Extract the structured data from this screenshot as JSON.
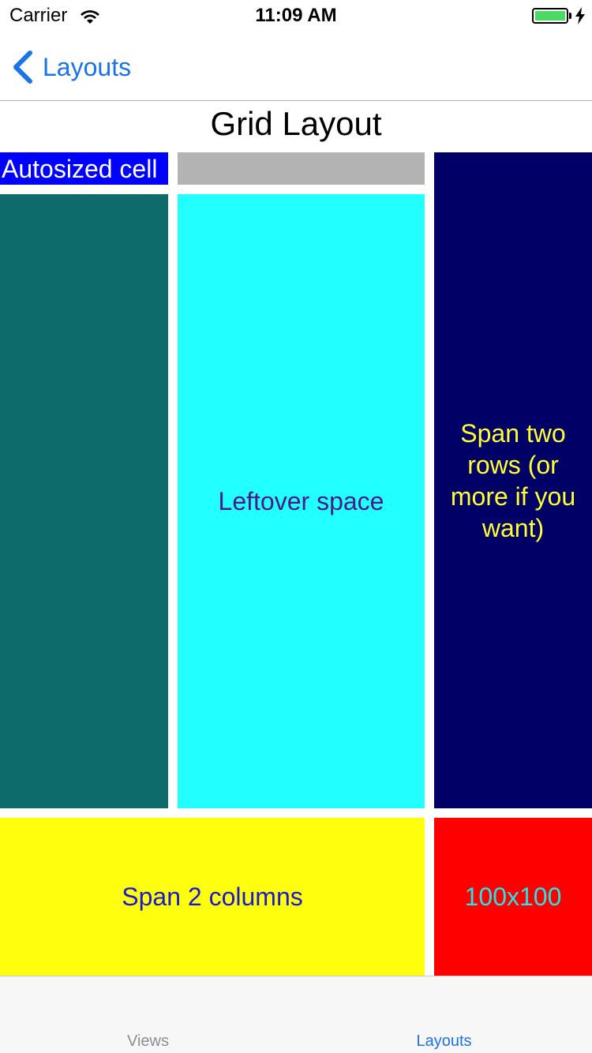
{
  "status_bar": {
    "carrier": "Carrier",
    "time": "11:09 AM",
    "icons": [
      "wifi-icon",
      "battery-icon",
      "charging-bolt-icon"
    ],
    "battery_level": 1.0
  },
  "nav_bar": {
    "back_label": "Layouts",
    "back_icon": "chevron-left-icon"
  },
  "page": {
    "title": "Grid Layout"
  },
  "grid": {
    "autosized": {
      "label": "Autosized cell",
      "bg": "#0000ff",
      "fg": "#ffffff"
    },
    "gray": {
      "label": "",
      "bg": "#b3b3b3"
    },
    "span_rows": {
      "label": "Span two rows (or more if you want)",
      "bg": "#000066",
      "fg": "#ffff33"
    },
    "teal": {
      "label": "",
      "bg": "#0d6b6b"
    },
    "leftover": {
      "label": "Leftover space",
      "bg": "#22ffff",
      "fg": "#4a1a8c"
    },
    "span_cols": {
      "label": "Span 2 columns",
      "bg": "#ffff0d",
      "fg": "#1a1acc"
    },
    "fixed": {
      "label": "100x100",
      "bg": "#ff0000",
      "fg": "#22e6e6"
    }
  },
  "tab_bar": {
    "tabs": [
      {
        "label": "Views",
        "selected": false
      },
      {
        "label": "Layouts",
        "selected": true
      }
    ],
    "selected_color": "#1a73e8",
    "unselected_color": "#8e8e93"
  },
  "colors": {
    "accent": "#1a73e8",
    "battery_green": "#4cd964"
  }
}
